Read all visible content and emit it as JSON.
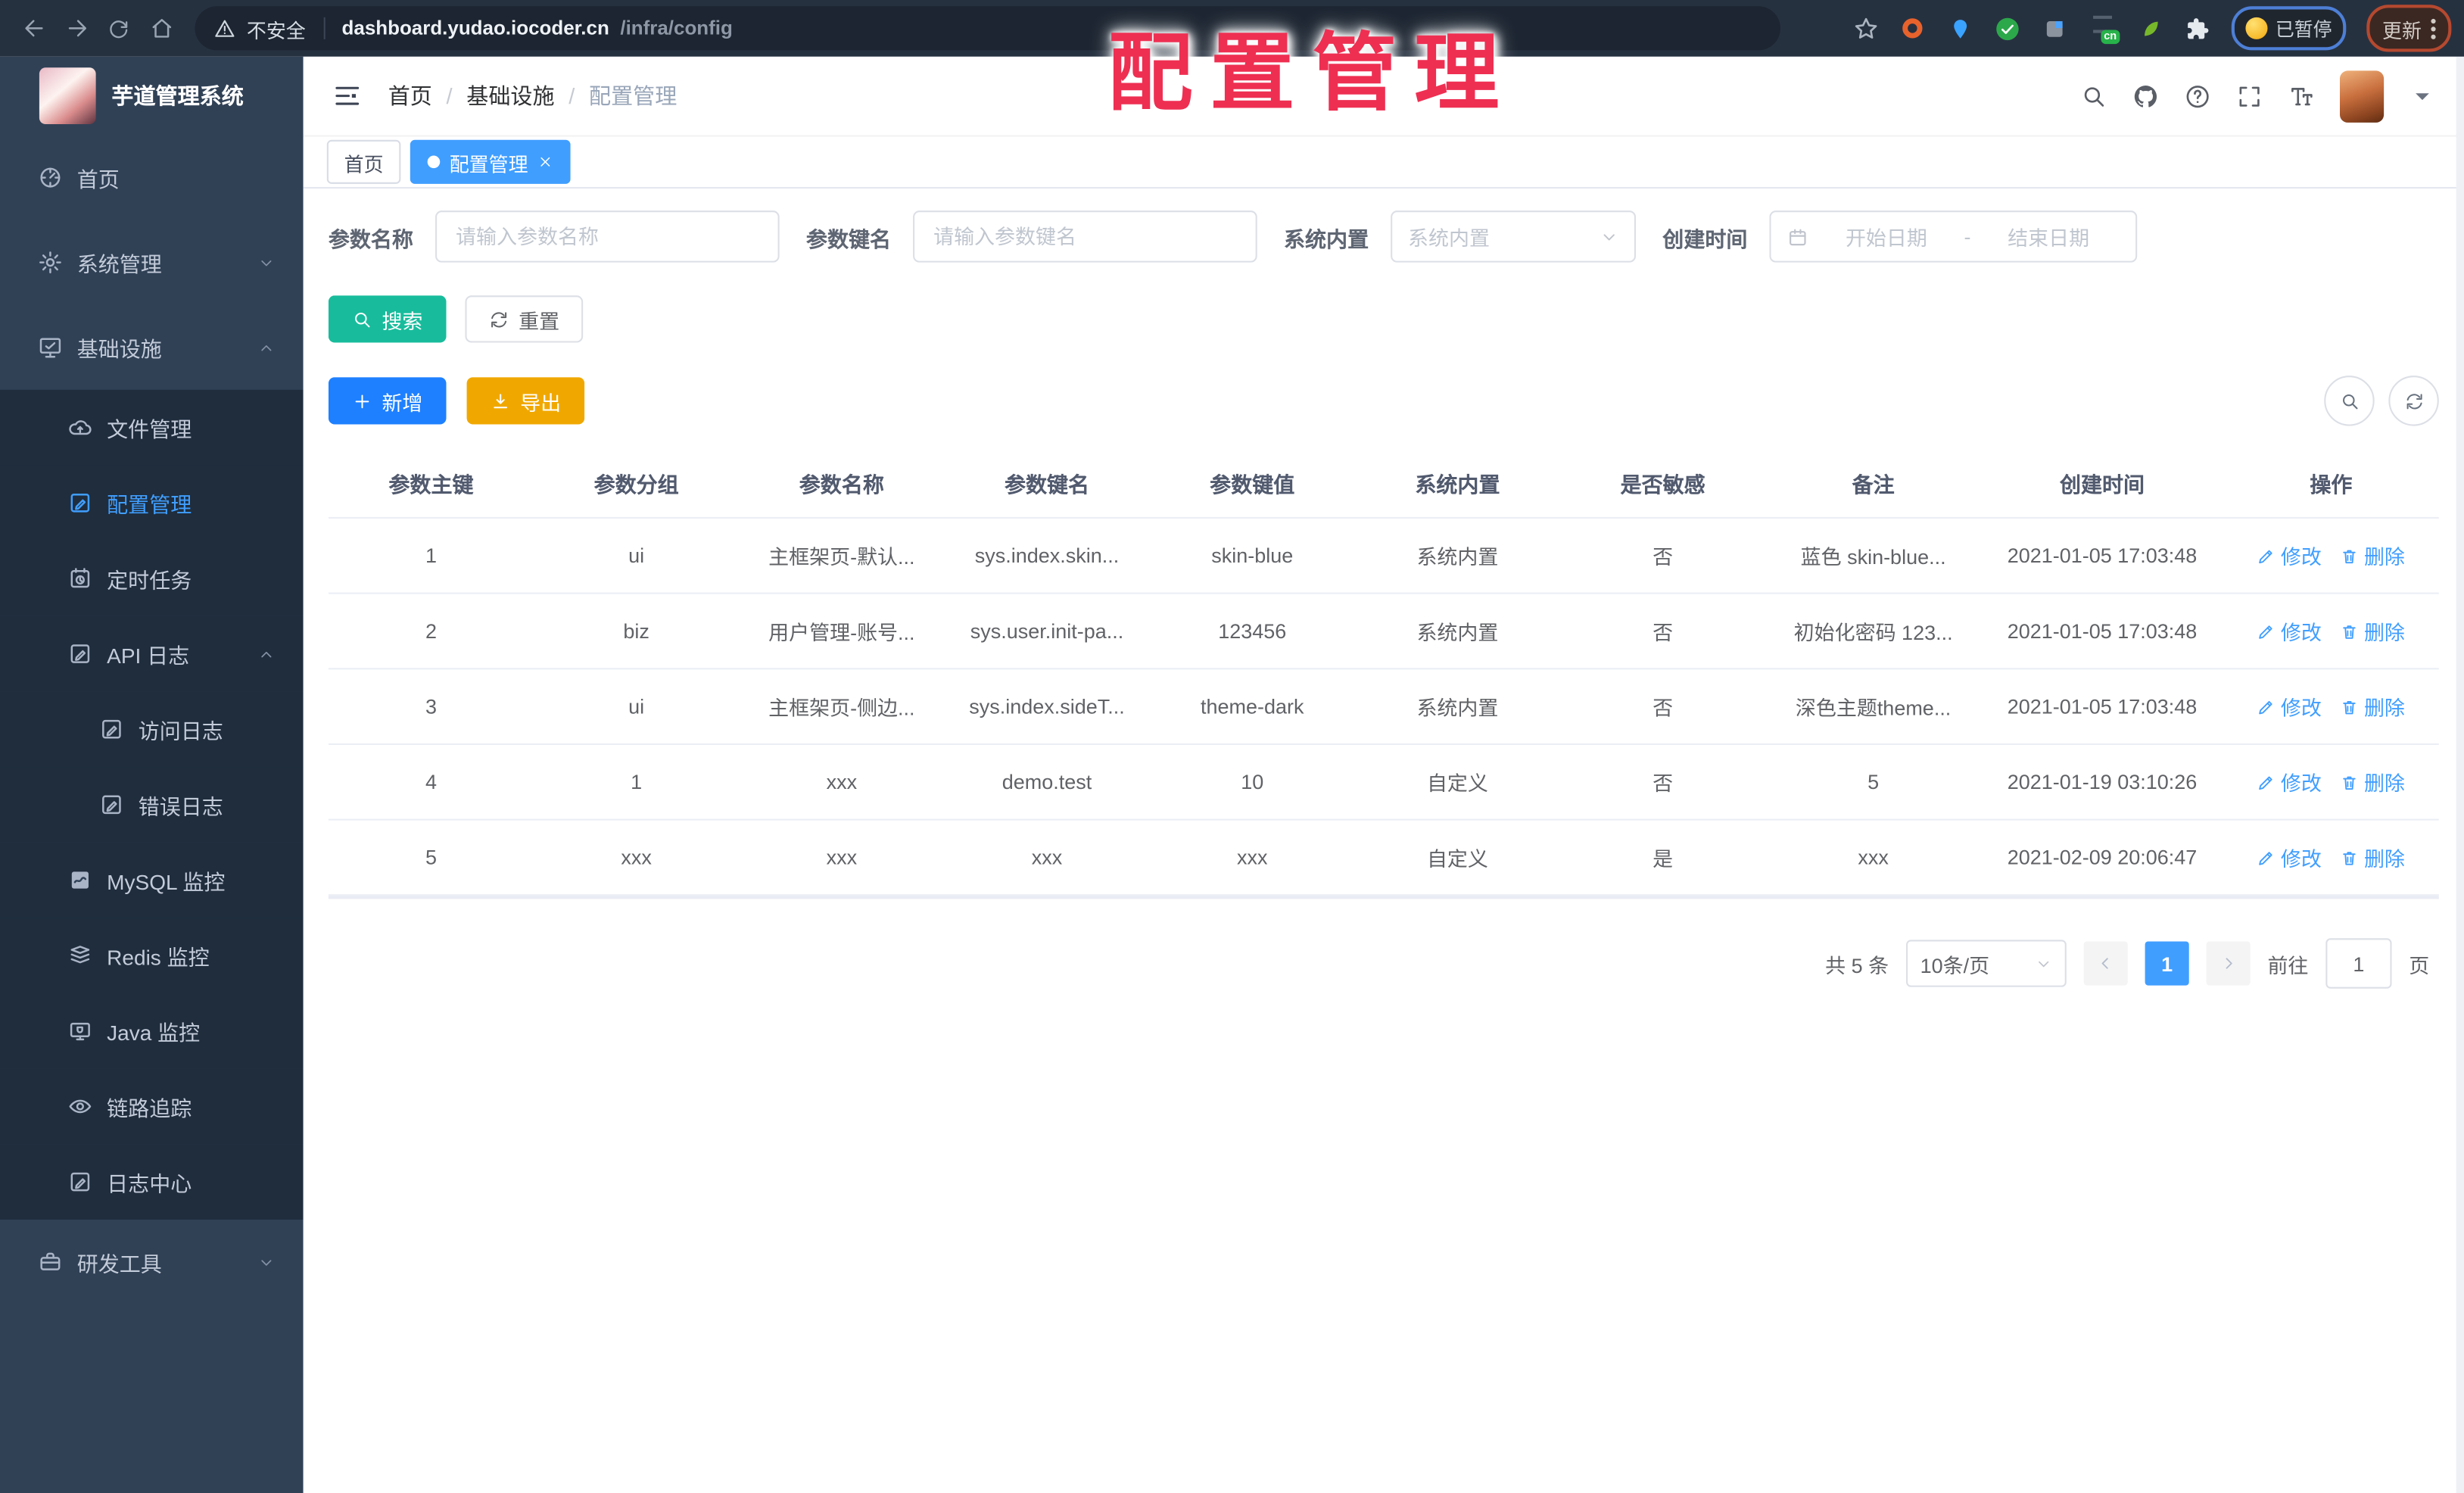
{
  "overlay": {
    "text": "配置管理"
  },
  "browser": {
    "security_label": "不安全",
    "url_host": "dashboard.yudao.iocoder.cn",
    "url_path": "/infra/config",
    "extension_cn_badge": "cn",
    "paused_label": "已暂停",
    "update_label": "更新"
  },
  "colors": {
    "accent": "#409eff",
    "success": "#18bc9c",
    "warning": "#f0a800",
    "overlay_red": "#ee2f52",
    "sidebar_bg": "#304156",
    "submenu_bg": "#1f2d3d",
    "chrome_bg": "#263140"
  },
  "sidebar": {
    "title": "芋道管理系统",
    "items": [
      {
        "label": "首页",
        "icon": "dashboard",
        "level": 0
      },
      {
        "label": "系统管理",
        "icon": "gear",
        "level": 0,
        "chevron": "down"
      },
      {
        "label": "基础设施",
        "icon": "infra",
        "level": 0,
        "chevron": "up"
      },
      {
        "label": "文件管理",
        "icon": "cloud",
        "level": 1,
        "group": true
      },
      {
        "label": "配置管理",
        "icon": "editsq",
        "level": 1,
        "group": true,
        "active": true
      },
      {
        "label": "定时任务",
        "icon": "clocksq",
        "level": 1,
        "group": true
      },
      {
        "label": "API 日志",
        "icon": "editsq",
        "level": 1,
        "group": true,
        "chevron": "up"
      },
      {
        "label": "访问日志",
        "icon": "editsq",
        "level": 2,
        "group": true
      },
      {
        "label": "错误日志",
        "icon": "editsq",
        "level": 2,
        "group": true
      },
      {
        "label": "MySQL 监控",
        "icon": "mysql",
        "level": 1,
        "group": true
      },
      {
        "label": "Redis 监控",
        "icon": "redis",
        "level": 1,
        "group": true
      },
      {
        "label": "Java 监控",
        "icon": "java",
        "level": 1,
        "group": true
      },
      {
        "label": "链路追踪",
        "icon": "eye",
        "level": 1,
        "group": true
      },
      {
        "label": "日志中心",
        "icon": "editsq",
        "level": 1,
        "group": true
      },
      {
        "label": "研发工具",
        "icon": "briefcase",
        "level": 0,
        "chevron": "down"
      }
    ]
  },
  "header": {
    "breadcrumb": [
      "首页",
      "基础设施",
      "配置管理"
    ],
    "breadcrumb_separator": "/",
    "tabs": [
      {
        "label": "首页",
        "active": false
      },
      {
        "label": "配置管理",
        "active": true,
        "closable": true
      }
    ]
  },
  "filters": {
    "name_label": "参数名称",
    "name_placeholder": "请输入参数名称",
    "key_label": "参数键名",
    "key_placeholder": "请输入参数键名",
    "builtin_label": "系统内置",
    "builtin_placeholder": "系统内置",
    "time_label": "创建时间",
    "time_start": "开始日期",
    "time_sep": "-",
    "time_end": "结束日期"
  },
  "toolbar": {
    "search": "搜索",
    "reset": "重置",
    "add": "新增",
    "export": "导出"
  },
  "table": {
    "columns": [
      "参数主键",
      "参数分组",
      "参数名称",
      "参数键名",
      "参数键值",
      "系统内置",
      "是否敏感",
      "备注",
      "创建时间",
      "操作"
    ],
    "edit_label": "修改",
    "delete_label": "删除",
    "rows": [
      {
        "cells": [
          "1",
          "ui",
          "主框架页-默认...",
          "sys.index.skin...",
          "skin-blue",
          "系统内置",
          "否",
          "蓝色 skin-blue...",
          "2021-01-05 17:03:48"
        ]
      },
      {
        "cells": [
          "2",
          "biz",
          "用户管理-账号...",
          "sys.user.init-pa...",
          "123456",
          "系统内置",
          "否",
          "初始化密码 123...",
          "2021-01-05 17:03:48"
        ]
      },
      {
        "cells": [
          "3",
          "ui",
          "主框架页-侧边...",
          "sys.index.sideT...",
          "theme-dark",
          "系统内置",
          "否",
          "深色主题theme...",
          "2021-01-05 17:03:48"
        ]
      },
      {
        "cells": [
          "4",
          "1",
          "xxx",
          "demo.test",
          "10",
          "自定义",
          "否",
          "5",
          "2021-01-19 03:10:26"
        ]
      },
      {
        "cells": [
          "5",
          "xxx",
          "xxx",
          "xxx",
          "xxx",
          "自定义",
          "是",
          "xxx",
          "2021-02-09 20:06:47"
        ]
      }
    ]
  },
  "pagination": {
    "total": "共 5 条",
    "page_size": "10条/页",
    "current": "1",
    "goto_label": "前往",
    "goto_value": "1",
    "unit": "页"
  }
}
